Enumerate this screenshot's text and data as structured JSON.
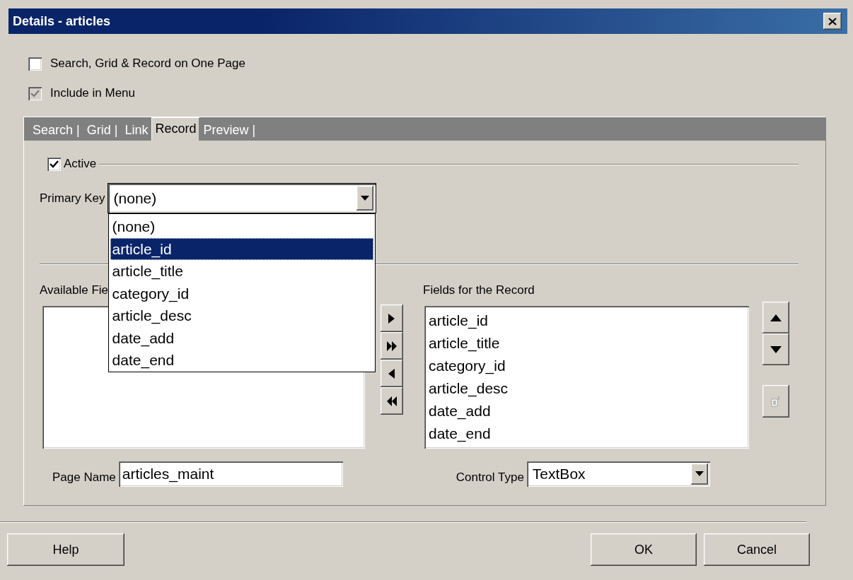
{
  "window": {
    "title": "Details - articles"
  },
  "options": [
    {
      "label": "Search, Grid & Record on One Page",
      "checked": false,
      "disabled": false
    },
    {
      "label": "Include in Menu",
      "checked": true,
      "disabled": true
    }
  ],
  "tabs": [
    {
      "label": "Search |",
      "selected": false
    },
    {
      "label": "Grid |",
      "selected": false
    },
    {
      "label": "Link",
      "selected": false
    },
    {
      "label": "Record",
      "selected": true
    },
    {
      "label": "Preview |",
      "selected": false
    }
  ],
  "record": {
    "active": {
      "label": "Active",
      "checked": true
    },
    "primary_key": {
      "label": "Primary Key",
      "value": "(none)",
      "expanded": true,
      "options": [
        {
          "label": "(none)",
          "highlighted": false
        },
        {
          "label": "article_id",
          "highlighted": true
        },
        {
          "label": "article_title",
          "highlighted": false
        },
        {
          "label": "category_id",
          "highlighted": false
        },
        {
          "label": "article_desc",
          "highlighted": false
        },
        {
          "label": "date_add",
          "highlighted": false
        },
        {
          "label": "date_end",
          "highlighted": false
        }
      ]
    },
    "available_fields": {
      "label": "Available Fie"
    },
    "fields_for_record": {
      "label": "Fields for the Record",
      "items": [
        "article_id",
        "article_title",
        "category_id",
        "article_desc",
        "date_add",
        "date_end"
      ]
    },
    "page_name": {
      "label": "Page Name",
      "value": "articles_maint"
    },
    "control_type": {
      "label": "Control Type",
      "value": "TextBox"
    }
  },
  "buttons": [
    {
      "label": "Help"
    },
    {
      "label": "OK"
    },
    {
      "label": "Cancel"
    }
  ]
}
